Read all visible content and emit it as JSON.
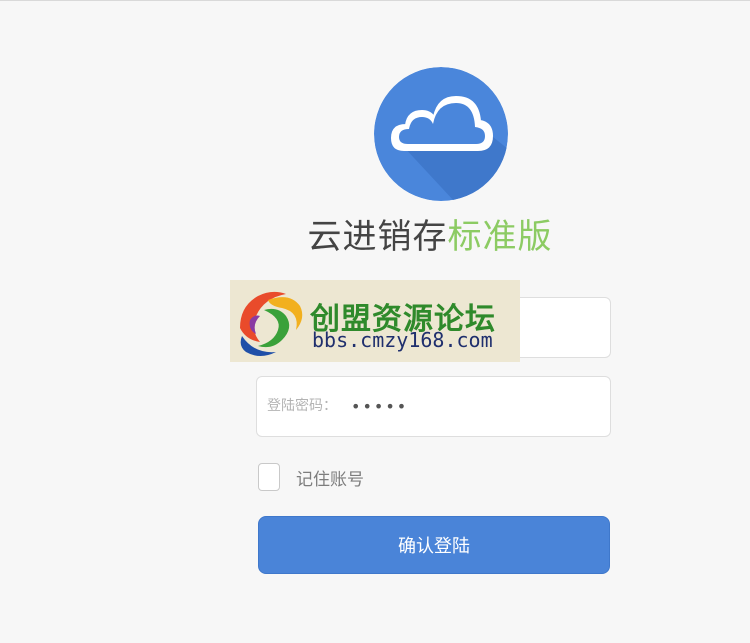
{
  "app": {
    "name": "云进销存",
    "edition": "标准版",
    "logo_icon": "cloud-icon"
  },
  "login": {
    "password_label": "登陆密码：",
    "password_value": "•••••",
    "remember_label": "记住账号",
    "remember_checked": false,
    "submit_label": "确认登陆"
  },
  "watermark": {
    "title": "创盟资源论坛",
    "url": "bbs.cmzy168.com"
  },
  "colors": {
    "logo_blue": "#4a86db",
    "edition_green": "#8ccb63",
    "button_blue": "#4a84d8"
  }
}
